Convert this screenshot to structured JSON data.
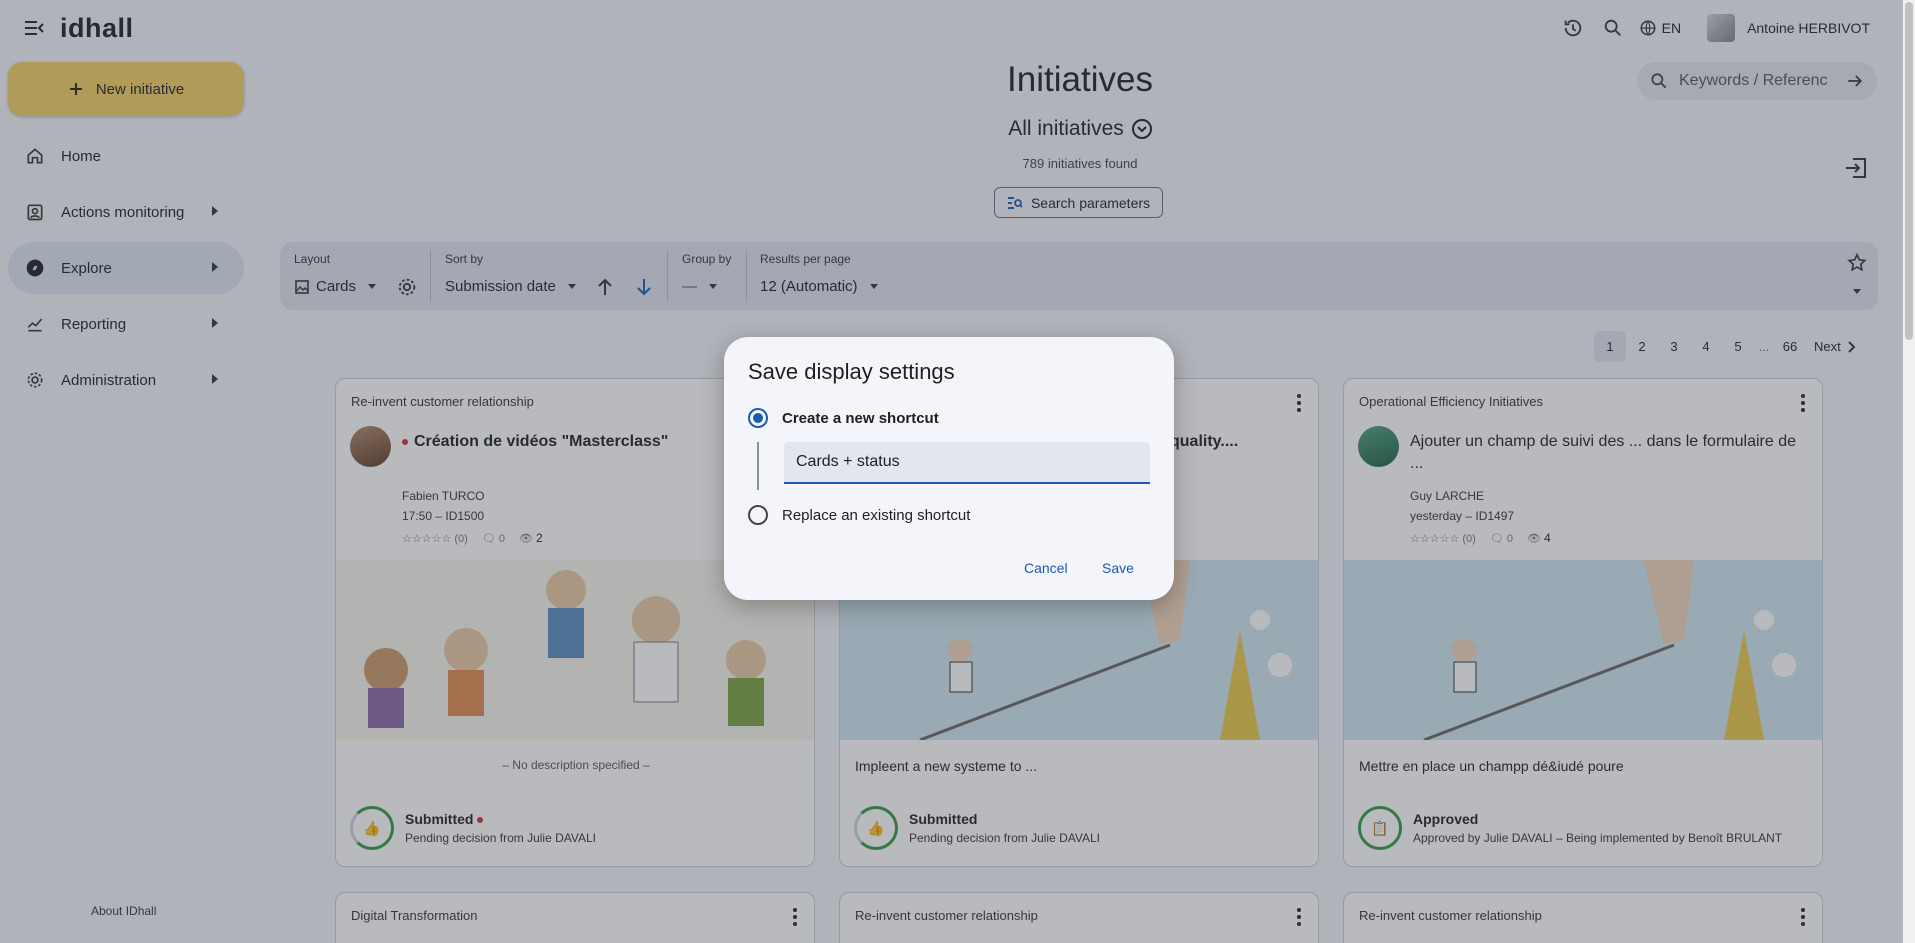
{
  "app": {
    "logo": "idhall"
  },
  "topbar": {
    "lang": "EN",
    "user_name": "Antoine HERBIVOT"
  },
  "sidebar": {
    "new_button": "New initiative",
    "items": [
      {
        "label": "Home",
        "icon": "home-icon"
      },
      {
        "label": "Actions monitoring",
        "icon": "clipboard-icon"
      },
      {
        "label": "Explore",
        "icon": "compass-icon"
      },
      {
        "label": "Reporting",
        "icon": "chart-icon"
      },
      {
        "label": "Administration",
        "icon": "gear-icon"
      }
    ],
    "about": "About IDhall"
  },
  "header": {
    "title": "Initiatives",
    "view": "All initiatives",
    "count_num": "789",
    "count_text": "initiatives found",
    "search_params": "Search parameters",
    "keyword_placeholder": "Keywords / Referenc"
  },
  "toolbar": {
    "layout_label": "Layout",
    "layout_value": "Cards",
    "sort_label": "Sort by",
    "sort_value": "Submission date",
    "group_label": "Group by",
    "group_value": "—",
    "results_label": "Results per page",
    "results_value": "12 (Automatic)"
  },
  "pagination": {
    "pages": [
      "1",
      "2",
      "3",
      "4",
      "5",
      "...",
      "66"
    ],
    "next": "Next",
    "current": "1"
  },
  "cards": [
    {
      "category": "Re-invent customer relationship",
      "title": "Création de vidéos \"Masterclass\"",
      "author": "Fabien TURCO",
      "meta": "17:50 – ID1500",
      "rating": "☆☆☆☆☆ (0)",
      "comments": "0",
      "views": "2",
      "description": "– No description specified –",
      "status": "Submitted",
      "status_sub": "Pending decision from Julie DAVALI"
    },
    {
      "category": "",
      "title": "quality....",
      "description": "Impleent a new systeme to ...",
      "status": "Submitted",
      "status_sub": "Pending decision from Julie DAVALI"
    },
    {
      "category": "Operational Efficiency Initiatives",
      "title": "Ajouter un champ de suivi des ... dans le formulaire de ...",
      "author": "Guy LARCHE",
      "meta": "yesterday – ID1497",
      "rating": "☆☆☆☆☆ (0)",
      "comments": "0",
      "views": "4",
      "description": "Mettre en place un champp dé&iudé poure",
      "status": "Approved",
      "status_sub": "Approved by Julie DAVALI – Being implemented by Benoît BRULANT"
    }
  ],
  "cards_row2": [
    "Digital Transformation",
    "Re-invent customer relationship",
    "Re-invent customer relationship"
  ],
  "dialog": {
    "title": "Save display settings",
    "option_new": "Create a new shortcut",
    "shortcut_name": "Cards + status",
    "option_replace": "Replace an existing shortcut",
    "cancel": "Cancel",
    "save": "Save"
  },
  "colors": {
    "accent": "#1a5bb0",
    "new_button": "#f1cf62",
    "status_green": "#2f9a45"
  }
}
